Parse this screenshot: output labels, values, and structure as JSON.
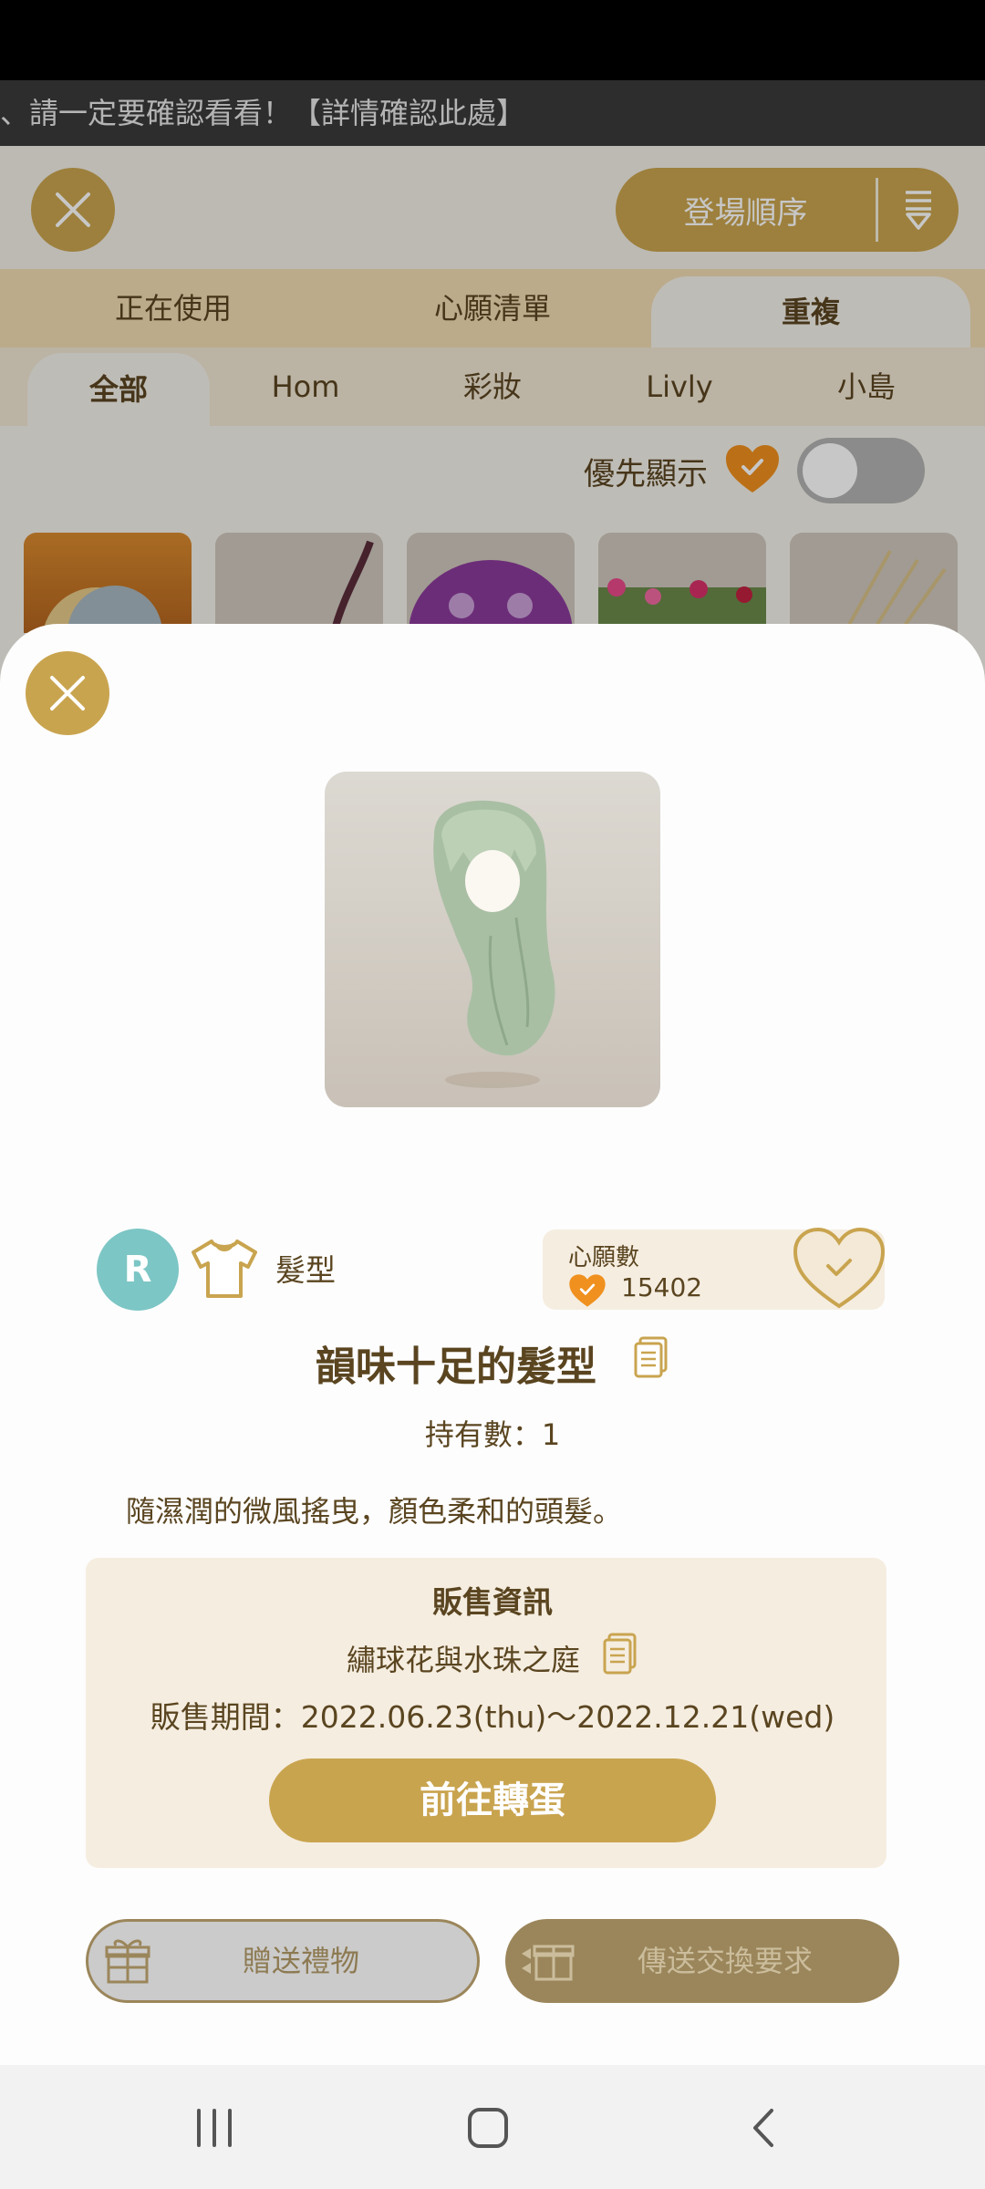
{
  "banner": {
    "text": "、請一定要確認看看！【詳情確認此處】"
  },
  "header": {
    "sort_label": "登場順序"
  },
  "tabs_main": [
    {
      "label": "正在使用"
    },
    {
      "label": "心願清單"
    },
    {
      "label": "重複"
    }
  ],
  "tabs_sub": [
    {
      "label": "全部"
    },
    {
      "label": "Hom"
    },
    {
      "label": "彩妝"
    },
    {
      "label": "Livly"
    },
    {
      "label": "小島"
    }
  ],
  "priority": {
    "label": "優先顯示",
    "enabled": false
  },
  "item": {
    "rarity": "R",
    "category": "髮型",
    "wish_label": "心願數",
    "wish_count": "15402",
    "name": "韻味十足的髮型",
    "owned": "持有數：1",
    "description": "隨濕潤的微風搖曳，顏色柔和的頭髮。"
  },
  "sale": {
    "title": "販售資訊",
    "event": "繡球花與水珠之庭",
    "period": "販售期間：2022.06.23(thu)～2022.12.21(wed)",
    "go_label": "前往轉蛋"
  },
  "actions": {
    "gift_label": "贈送禮物",
    "trade_label": "傳送交換要求"
  },
  "colors": {
    "accent": "#c9a44f",
    "text": "#5a4520",
    "rarity": "#7cc6c5",
    "heart": "#f0901e"
  }
}
